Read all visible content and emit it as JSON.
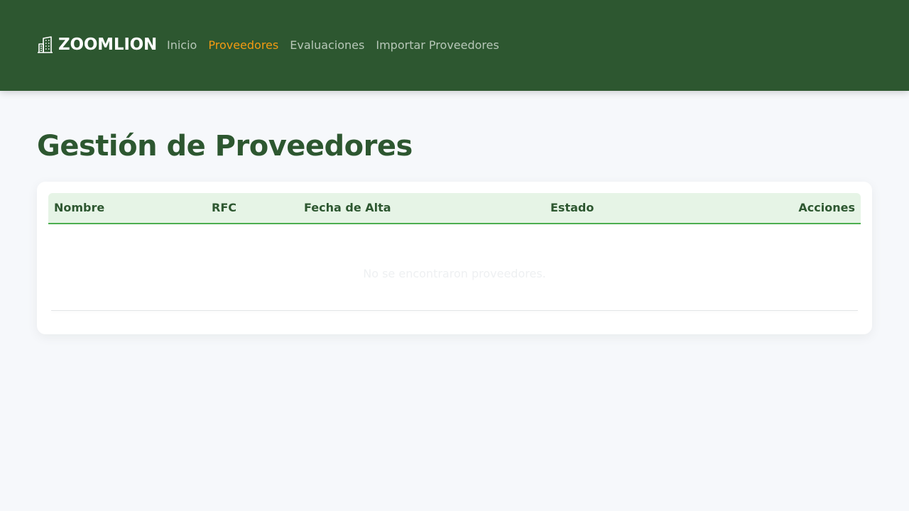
{
  "brand": {
    "name": "ZOOMLION",
    "icon": "building-icon"
  },
  "nav": {
    "items": [
      {
        "label": "Inicio",
        "active": false
      },
      {
        "label": "Proveedores",
        "active": true
      },
      {
        "label": "Evaluaciones",
        "active": false
      },
      {
        "label": "Importar Proveedores",
        "active": false
      }
    ]
  },
  "page": {
    "title": "Gestión de Proveedores"
  },
  "table": {
    "columns": [
      "Nombre",
      "RFC",
      "Fecha de Alta",
      "Estado",
      "Acciones"
    ],
    "rows": [],
    "empty_message": "No se encontraron proveedores."
  },
  "colors": {
    "navbar": "#2d5730",
    "accent_active": "#f39a12",
    "title": "#2d5730",
    "header_bg": "#e6f4e6",
    "header_border": "#4caf50"
  }
}
